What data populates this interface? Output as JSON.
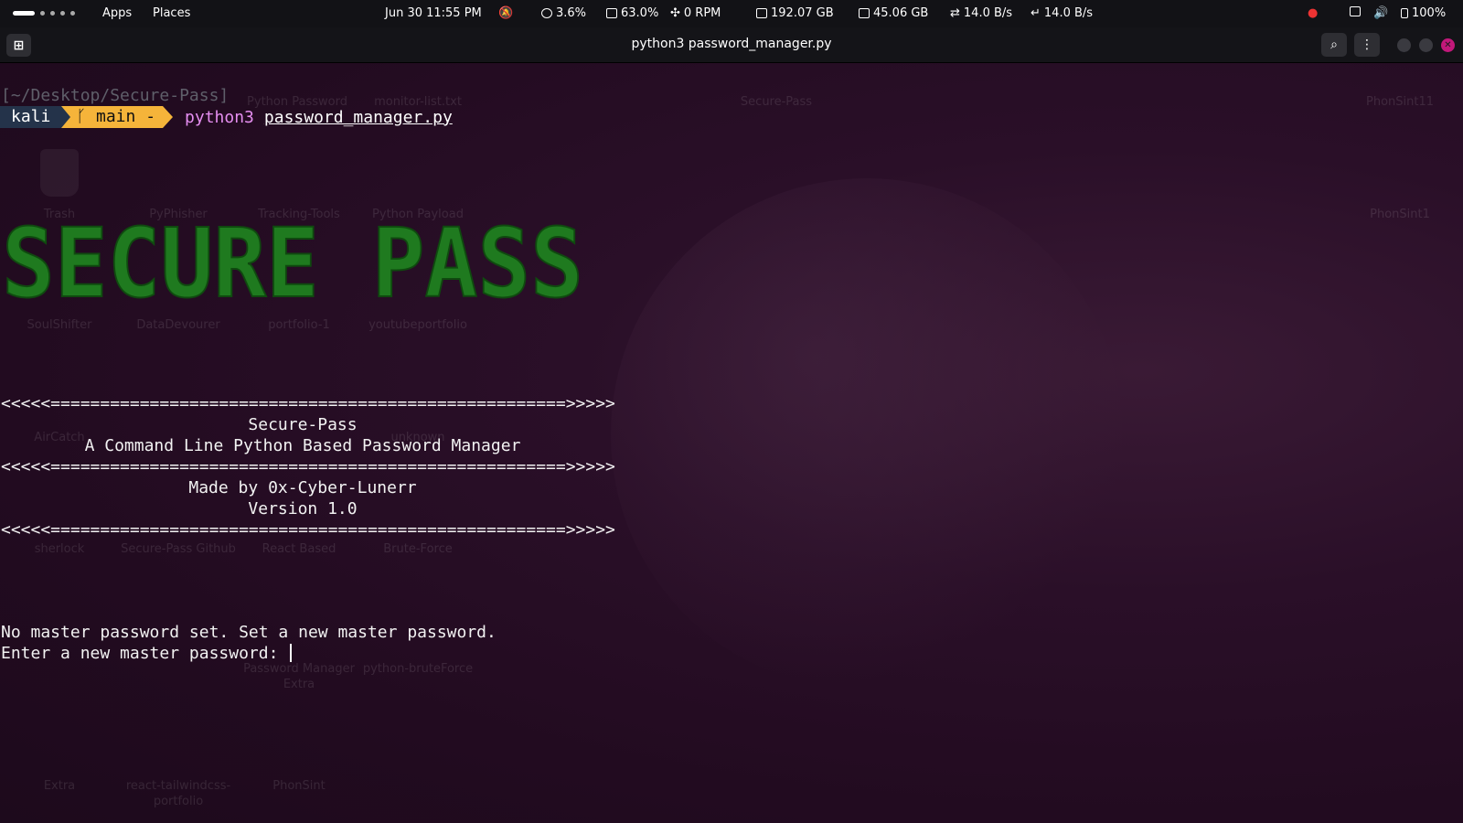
{
  "topbar": {
    "apps_label": "Apps",
    "places_label": "Places",
    "datetime": "Jun 30  11:55 PM",
    "cpu": "3.6%",
    "ram": "63.0%",
    "fan": "0 RPM",
    "disk1": "192.07 GB",
    "disk2": "45.06 GB",
    "net_up": "14.0 B/s",
    "net_down": "14.0 B/s",
    "battery": "100%",
    "icons": [
      "notification-bell-icon",
      "cpu-icon",
      "memory-icon",
      "fan-icon",
      "disk-icon",
      "disk-icon",
      "upload-icon",
      "download-icon",
      "vpn-icon",
      "screen-icon",
      "volume-icon",
      "battery-icon"
    ]
  },
  "window": {
    "title": "python3 password_manager.py",
    "buttons": [
      "new-tab-icon",
      "search-icon",
      "menu-icon",
      "minimize",
      "maximize",
      "close-icon"
    ]
  },
  "terminal": {
    "cwd": "[~/Desktop/Secure-Pass]",
    "prompt_user": "kali",
    "prompt_branch": " main -",
    "command": "python3",
    "argument": "password_manager.py",
    "banner_text": "SECURE PASS",
    "separator": "<<<<<====================================================>>>>>",
    "app_name": "Secure-Pass",
    "tagline": "A Command Line Python Based Password Manager",
    "author": "Made by 0x-Cyber-Lunerr",
    "version": "Version 1.0",
    "msg1": "No master password set. Set a new master password.",
    "msg2": "Enter a new master password: "
  },
  "desktop_icons": [
    "Python Password",
    "monitor-list.txt",
    "Secure-Pass",
    "PhonSint11",
    "Trash",
    "PyPhisher",
    "Tracking-Tools",
    "Python Payload",
    "PhonSint1",
    "SoulShifter",
    "DataDevourer",
    "portfolio-1",
    "youtubeportfolio",
    "AirCatch",
    "unknown",
    "sherlock",
    "Secure-Pass Github",
    "React Based",
    "Brute-Force",
    "Password Manager Extra",
    "python-bruteForce",
    "Extra",
    "react-tailwindcss-portfolio",
    "PhonSint"
  ],
  "colors": {
    "banner_green": "#1f7a1f",
    "prompt_user_bg": "#24334a",
    "prompt_git_bg": "#f5b43a",
    "command_color": "#e58ef0",
    "close_button": "#c2187a"
  }
}
